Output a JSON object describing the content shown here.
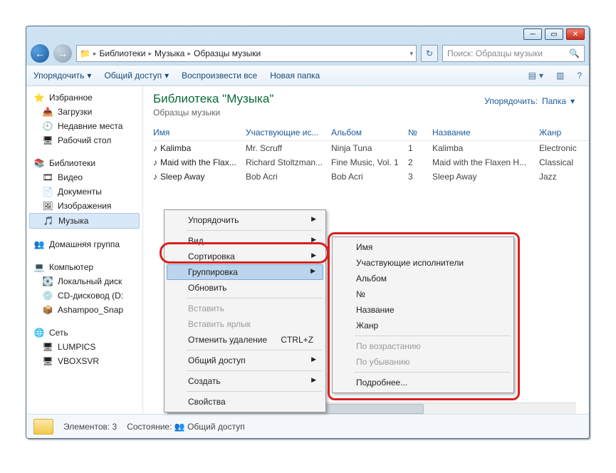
{
  "window_controls": {
    "min": "─",
    "max": "▭",
    "close": "✕"
  },
  "nav": {
    "back": "←",
    "forward": "→"
  },
  "address": {
    "icon": "📁",
    "segments": [
      "Библиотеки",
      "Музыка",
      "Образцы музыки"
    ]
  },
  "search": {
    "placeholder": "Поиск: Образцы музыки",
    "icon": "🔍"
  },
  "refresh_icon": "↻",
  "toolbar": {
    "organize": "Упорядочить",
    "share": "Общий доступ",
    "play_all": "Воспроизвести все",
    "new_folder": "Новая папка",
    "view_icon": "▤",
    "help_icon": "?"
  },
  "sidebar": {
    "favorites": {
      "head": "Избранное",
      "icon": "⭐",
      "items": [
        {
          "icon": "📥",
          "label": "Загрузки"
        },
        {
          "icon": "🕘",
          "label": "Недавние места"
        },
        {
          "icon": "🖥",
          "label": "Рабочий стол"
        }
      ]
    },
    "libraries": {
      "head": "Библиотеки",
      "icon": "📚",
      "items": [
        {
          "icon": "🎞",
          "label": "Видео"
        },
        {
          "icon": "📄",
          "label": "Документы"
        },
        {
          "icon": "🖼",
          "label": "Изображения"
        },
        {
          "icon": "🎵",
          "label": "Музыка",
          "selected": true
        }
      ]
    },
    "homegroup": {
      "head": "Домашняя группа",
      "icon": "👥"
    },
    "computer": {
      "head": "Компьютер",
      "icon": "💻",
      "items": [
        {
          "icon": "💽",
          "label": "Локальный диск"
        },
        {
          "icon": "💿",
          "label": "CD-дисковод (D:"
        },
        {
          "icon": "📦",
          "label": "Ashampoo_Snap"
        }
      ]
    },
    "network": {
      "head": "Сеть",
      "icon": "🌐",
      "items": [
        {
          "icon": "🖥",
          "label": "LUMPICS"
        },
        {
          "icon": "🖥",
          "label": "VBOXSVR"
        }
      ]
    }
  },
  "library": {
    "title": "Библиотека \"Музыка\"",
    "subtitle": "Образцы музыки",
    "arrange_label": "Упорядочить:",
    "arrange_value": "Папка"
  },
  "columns": {
    "name": "Имя",
    "artist": "Участвующие ис...",
    "album": "Альбом",
    "num": "№",
    "title": "Название",
    "genre": "Жанр"
  },
  "files": [
    {
      "name": "Kalimba",
      "artist": "Mr. Scruff",
      "album": "Ninja Tuna",
      "num": "1",
      "title": "Kalimba",
      "genre": "Electronic"
    },
    {
      "name": "Maid with the Flax...",
      "artist": "Richard Stoltzman...",
      "album": "Fine Music, Vol. 1",
      "num": "2",
      "title": "Maid with the Flaxen H...",
      "genre": "Classical"
    },
    {
      "name": "Sleep Away",
      "artist": "Bob Acri",
      "album": "Bob Acri",
      "num": "3",
      "title": "Sleep Away",
      "genre": "Jazz"
    }
  ],
  "context_menu": {
    "arrange": "Упорядочить",
    "view": "Вид",
    "sort": "Сортировка",
    "group": "Группировка",
    "refresh": "Обновить",
    "paste": "Вставить",
    "paste_link": "Вставить ярлык",
    "undo": "Отменить удаление",
    "undo_key": "CTRL+Z",
    "share": "Общий доступ",
    "create": "Создать",
    "props": "Свойства"
  },
  "submenu": {
    "name": "Имя",
    "artists": "Участвующие исполнители",
    "album": "Альбом",
    "num": "№",
    "title": "Название",
    "genre": "Жанр",
    "asc": "По возрастанию",
    "desc": "По убыванию",
    "more": "Подробнее..."
  },
  "status": {
    "elements": "Элементов: 3",
    "state_label": "Состояние:",
    "state_icon": "👥",
    "state_value": "Общий доступ"
  }
}
